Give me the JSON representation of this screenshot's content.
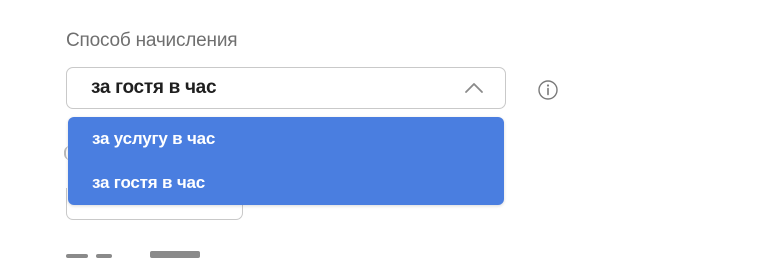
{
  "field": {
    "label": "Способ начисления",
    "selected_value": "за гостя в час"
  },
  "dropdown": {
    "options": [
      {
        "label": "за услугу в час"
      },
      {
        "label": "за гостя в час"
      }
    ]
  },
  "colors": {
    "label_text": "#6f6f6f",
    "select_border": "#c9c9c9",
    "dropdown_bg": "#4a7ee0",
    "option_text": "#ffffff"
  },
  "icons": {
    "chevron": "chevron-up-icon",
    "info": "info-icon"
  }
}
